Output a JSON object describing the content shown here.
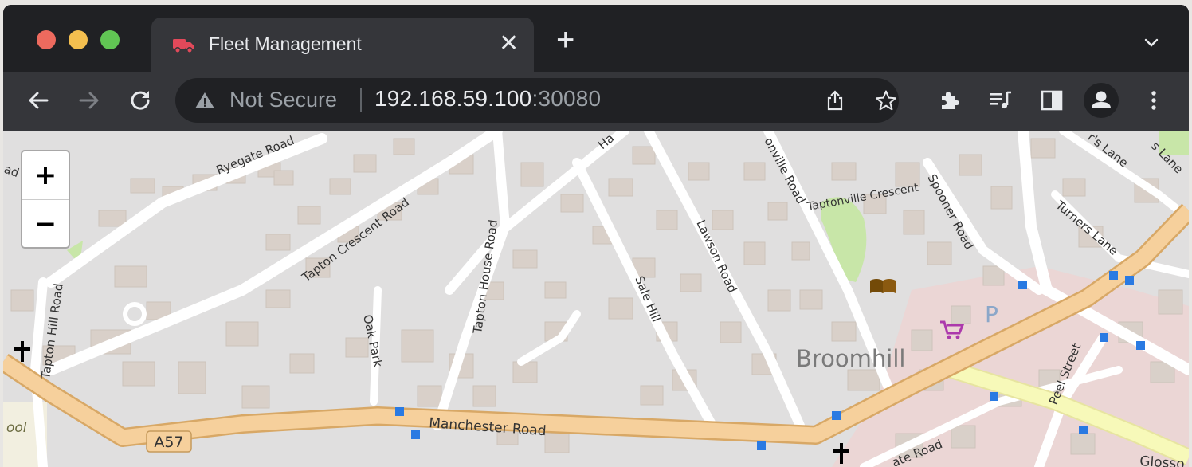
{
  "browser": {
    "tab": {
      "title": "Fleet Management",
      "favicon": "truck-icon",
      "close": "✕"
    },
    "new_tab": "+",
    "omnibox": {
      "security_label": "Not Secure",
      "url_host": "192.168.59.100",
      "url_port": ":30080"
    }
  },
  "map": {
    "zoom_in": "+",
    "zoom_out": "−",
    "labels": {
      "ryegate_road": "Ryegate Road",
      "tapton_crescent_road": "Tapton Crescent Road",
      "tapton_house_road": "Tapton House Road",
      "oak_park": "Oak Park",
      "tapton_hill_road": "Tapton Hill Road",
      "sale_hill": "Sale Hill",
      "lawson_road": "Lawson Road",
      "taptonville_road": "onville Road",
      "taptonville_crescent": "Taptonville Crescent",
      "spooner_road": "Spooner Road",
      "turners_lane": "Turners Lane",
      "turners_lane_top": "r's Lane",
      "peel_street": "Peel Street",
      "broomhill": "Broomhill",
      "manchester_road": "Manchester Road",
      "a57": "A57",
      "glossop": "Glosso",
      "ate_road": "ate Road",
      "ad": "ad",
      "ha": "Ha",
      "school": "ool",
      "parking": "P",
      "s_lane": "s Lane"
    },
    "colors": {
      "background": "#e0dfdf",
      "building": "#d9d0c9",
      "main_road": "#f6d09c",
      "secondary_road": "#f7f9b9",
      "stop": "#2a7ae2",
      "park": "#c8e6a8"
    }
  }
}
